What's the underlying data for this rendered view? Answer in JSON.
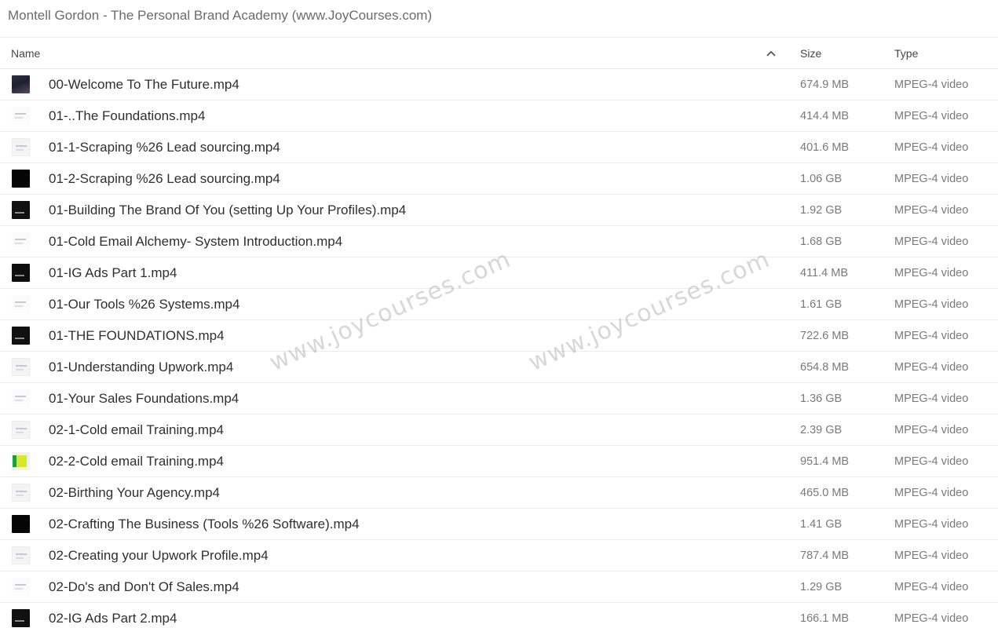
{
  "window": {
    "title": "Montell Gordon - The Personal Brand Academy (www.JoyCourses.com)"
  },
  "columns": {
    "name": "Name",
    "size": "Size",
    "type": "Type"
  },
  "sort_icon": "chevron-up-icon",
  "watermarks": [
    "www.joycourses.com",
    "www.joycourses.com"
  ],
  "files": [
    {
      "name": "00-Welcome To The Future.mp4",
      "size": "674.9 MB",
      "type": "MPEG-4 video",
      "thumb": "person"
    },
    {
      "name": "01-..The Foundations.mp4",
      "size": "414.4 MB",
      "type": "MPEG-4 video",
      "thumb": "white"
    },
    {
      "name": "01-1-Scraping %26 Lead sourcing.mp4",
      "size": "401.6 MB",
      "type": "MPEG-4 video",
      "thumb": "light"
    },
    {
      "name": "01-2-Scraping %26 Lead sourcing.mp4",
      "size": "1.06 GB",
      "type": "MPEG-4 video",
      "thumb": "black"
    },
    {
      "name": "01-Building The Brand Of You (setting Up Your Profiles).mp4",
      "size": "1.92 GB",
      "type": "MPEG-4 video",
      "thumb": "dark"
    },
    {
      "name": "01-Cold Email Alchemy- System Introduction.mp4",
      "size": "1.68 GB",
      "type": "MPEG-4 video",
      "thumb": "white"
    },
    {
      "name": "01-IG Ads Part 1.mp4",
      "size": "411.4 MB",
      "type": "MPEG-4 video",
      "thumb": "screen"
    },
    {
      "name": "01-Our Tools %26 Systems.mp4",
      "size": "1.61 GB",
      "type": "MPEG-4 video",
      "thumb": "white"
    },
    {
      "name": "01-THE FOUNDATIONS.mp4",
      "size": "722.6 MB",
      "type": "MPEG-4 video",
      "thumb": "dark"
    },
    {
      "name": "01-Understanding Upwork.mp4",
      "size": "654.8 MB",
      "type": "MPEG-4 video",
      "thumb": "light"
    },
    {
      "name": "01-Your Sales Foundations.mp4",
      "size": "1.36 GB",
      "type": "MPEG-4 video",
      "thumb": "white"
    },
    {
      "name": "02-1-Cold email Training.mp4",
      "size": "2.39 GB",
      "type": "MPEG-4 video",
      "thumb": "light"
    },
    {
      "name": "02-2-Cold email Training.mp4",
      "size": "951.4 MB",
      "type": "MPEG-4 video",
      "thumb": "green"
    },
    {
      "name": "02-Birthing Your Agency.mp4",
      "size": "465.0 MB",
      "type": "MPEG-4 video",
      "thumb": "light"
    },
    {
      "name": "02-Crafting The Business (Tools %26 Software).mp4",
      "size": "1.41 GB",
      "type": "MPEG-4 video",
      "thumb": "black"
    },
    {
      "name": "02-Creating your Upwork Profile.mp4",
      "size": "787.4 MB",
      "type": "MPEG-4 video",
      "thumb": "light"
    },
    {
      "name": "02-Do's and Don't Of Sales.mp4",
      "size": "1.29 GB",
      "type": "MPEG-4 video",
      "thumb": "white"
    },
    {
      "name": "02-IG Ads Part 2.mp4",
      "size": "166.1 MB",
      "type": "MPEG-4 video",
      "thumb": "dark"
    }
  ]
}
